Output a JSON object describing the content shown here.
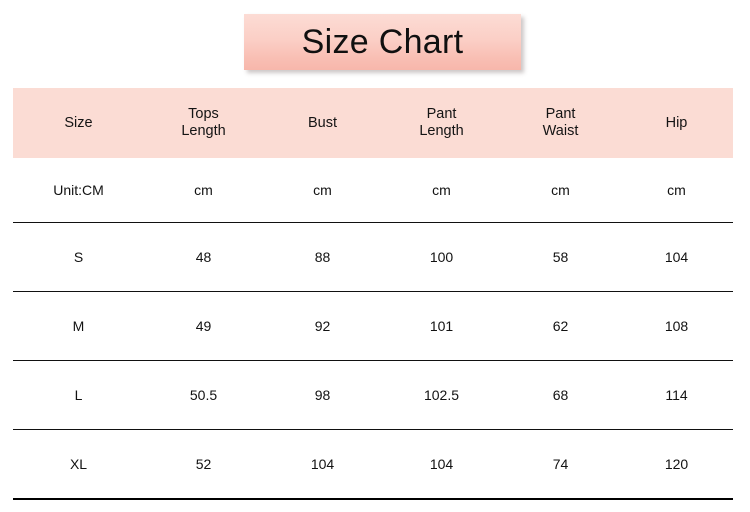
{
  "title": {
    "text": "Size Chart"
  },
  "colors": {
    "banner_top": "#fcdcd5",
    "banner_bottom": "#f7b7ab",
    "header_band": "#fbdcd4",
    "rule": "#111111",
    "text": "#121212"
  },
  "table": {
    "headers": [
      "Size",
      "Tops\nLength",
      "Bust",
      "Pant\nLength",
      "Pant\nWaist",
      "Hip"
    ],
    "unit_row": [
      "Unit:CM",
      "cm",
      "cm",
      "cm",
      "cm",
      "cm"
    ],
    "rows": [
      {
        "size": "S",
        "tops_length": "48",
        "bust": "88",
        "pant_length": "100",
        "pant_waist": "58",
        "hip": "104"
      },
      {
        "size": "M",
        "tops_length": "49",
        "bust": "92",
        "pant_length": "101",
        "pant_waist": "62",
        "hip": "108"
      },
      {
        "size": "L",
        "tops_length": "50.5",
        "bust": "98",
        "pant_length": "102.5",
        "pant_waist": "68",
        "hip": "114"
      },
      {
        "size": "XL",
        "tops_length": "52",
        "bust": "104",
        "pant_length": "104",
        "pant_waist": "74",
        "hip": "120"
      }
    ]
  }
}
